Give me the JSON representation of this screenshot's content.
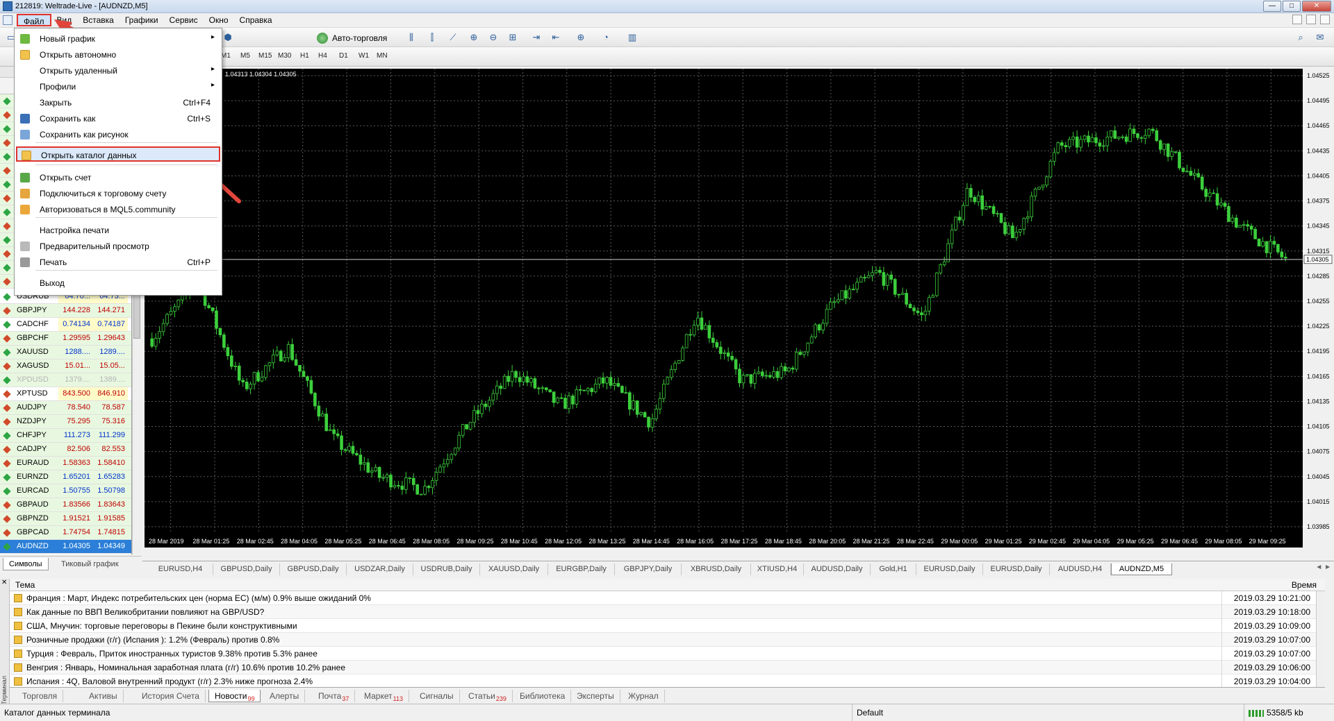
{
  "window": {
    "title": "212819: Weltrade-Live - [AUDNZD,M5]",
    "min_label": "—",
    "max_label": "□",
    "close_label": "✕"
  },
  "menubar": {
    "items": [
      "Файл",
      "Вид",
      "Вставка",
      "Графики",
      "Сервис",
      "Окно",
      "Справка"
    ],
    "active_index": 0
  },
  "toolbar": {
    "autotrade_label": "Авто-торговля",
    "timeframes": [
      "M1",
      "M5",
      "M15",
      "M30",
      "H1",
      "H4",
      "D1",
      "W1",
      "MN"
    ],
    "icons": [
      "bars-icon",
      "candles-icon",
      "line-chart-icon",
      "zoom-in-icon",
      "zoom-out-icon",
      "tile-icon",
      "autoscroll-icon",
      "shift-icon",
      "indicators-icon",
      "periods-icon",
      "templates-icon"
    ]
  },
  "file_menu": {
    "items": [
      {
        "label": "Новый график",
        "shortcut": "",
        "submenu": true,
        "icon": "new-chart-icon"
      },
      {
        "label": "Открыть автономно",
        "shortcut": "",
        "submenu": false,
        "icon": "open-offline-icon"
      },
      {
        "label": "Открыть удаленный",
        "shortcut": "",
        "submenu": true,
        "icon": ""
      },
      {
        "label": "Профили",
        "shortcut": "",
        "submenu": true,
        "icon": ""
      },
      {
        "label": "Закрыть",
        "shortcut": "Ctrl+F4",
        "submenu": false,
        "icon": ""
      },
      {
        "label": "Сохранить как",
        "shortcut": "Ctrl+S",
        "submenu": false,
        "icon": "save-icon"
      },
      {
        "label": "Сохранить как рисунок",
        "shortcut": "",
        "submenu": false,
        "icon": "save-image-icon"
      },
      {
        "label": "Открыть каталог данных",
        "shortcut": "",
        "submenu": false,
        "icon": "folder-icon"
      },
      {
        "label": "Открыть счет",
        "shortcut": "",
        "submenu": false,
        "icon": "open-account-icon"
      },
      {
        "label": "Подключиться к торговому счету",
        "shortcut": "",
        "submenu": false,
        "icon": "connect-icon"
      },
      {
        "label": "Авторизоваться в MQL5.community",
        "shortcut": "",
        "submenu": false,
        "icon": "mql5-icon"
      },
      {
        "label": "Настройка печати",
        "shortcut": "",
        "submenu": false,
        "icon": ""
      },
      {
        "label": "Предварительный просмотр",
        "shortcut": "",
        "submenu": false,
        "icon": "print-preview-icon"
      },
      {
        "label": "Печать",
        "shortcut": "Ctrl+P",
        "submenu": false,
        "icon": "print-icon"
      },
      {
        "label": "Выход",
        "shortcut": "",
        "submenu": false,
        "icon": ""
      }
    ],
    "highlighted_index": 7
  },
  "market_watch": {
    "rows": [
      {
        "symbol": "USDRUB",
        "bid": "64.70...",
        "ask": "64.73...",
        "dir": "up",
        "style": "normal"
      },
      {
        "symbol": "GBPJPY",
        "bid": "144.228",
        "ask": "144.271",
        "dir": "down",
        "style": "normal"
      },
      {
        "symbol": "CADCHF",
        "bid": "0.74134",
        "ask": "0.74187",
        "dir": "up",
        "style": "normal"
      },
      {
        "symbol": "GBPCHF",
        "bid": "1.29595",
        "ask": "1.29643",
        "dir": "down",
        "style": "normal"
      },
      {
        "symbol": "XAUUSD",
        "bid": "1288....",
        "ask": "1289....",
        "dir": "up",
        "style": "normal"
      },
      {
        "symbol": "XAGUSD",
        "bid": "15.01...",
        "ask": "15.05...",
        "dir": "down",
        "style": "normal"
      },
      {
        "symbol": "XPDUSD",
        "bid": "1379....",
        "ask": "1389....",
        "dir": "up",
        "style": "grey"
      },
      {
        "symbol": "XPTUSD",
        "bid": "843.500",
        "ask": "846.910",
        "dir": "down",
        "style": "normal"
      },
      {
        "symbol": "AUDJPY",
        "bid": "78.540",
        "ask": "78.587",
        "dir": "down",
        "style": "normal"
      },
      {
        "symbol": "NZDJPY",
        "bid": "75.295",
        "ask": "75.316",
        "dir": "down",
        "style": "normal"
      },
      {
        "symbol": "CHFJPY",
        "bid": "111.273",
        "ask": "111.299",
        "dir": "up",
        "style": "normal"
      },
      {
        "symbol": "CADJPY",
        "bid": "82.506",
        "ask": "82.553",
        "dir": "down",
        "style": "normal"
      },
      {
        "symbol": "EURAUD",
        "bid": "1.58363",
        "ask": "1.58410",
        "dir": "down",
        "style": "normal"
      },
      {
        "symbol": "EURNZD",
        "bid": "1.65201",
        "ask": "1.65283",
        "dir": "up",
        "style": "normal"
      },
      {
        "symbol": "EURCAD",
        "bid": "1.50755",
        "ask": "1.50798",
        "dir": "up",
        "style": "normal"
      },
      {
        "symbol": "GBPAUD",
        "bid": "1.83566",
        "ask": "1.83643",
        "dir": "down",
        "style": "normal"
      },
      {
        "symbol": "GBPNZD",
        "bid": "1.91521",
        "ask": "1.91585",
        "dir": "down",
        "style": "normal"
      },
      {
        "symbol": "GBPCAD",
        "bid": "1.74754",
        "ask": "1.74815",
        "dir": "down",
        "style": "normal"
      },
      {
        "symbol": "AUDNZD",
        "bid": "1.04305",
        "ask": "1.04349",
        "dir": "up",
        "style": "selected"
      }
    ],
    "tabs": [
      "Символы",
      "Тиковый график"
    ],
    "active_tab": 0
  },
  "chart": {
    "info": "1.04313 1.04304 1.04305",
    "current_price": "1.04305",
    "price_labels": [
      "1.04525",
      "1.04495",
      "1.04465",
      "1.04435",
      "1.04405",
      "1.04375",
      "1.04345",
      "1.04315",
      "1.04285",
      "1.04255",
      "1.04225",
      "1.04195",
      "1.04165",
      "1.04135",
      "1.04105",
      "1.04075",
      "1.04045",
      "1.04015",
      "1.03985"
    ],
    "time_labels": [
      "28 Mar 2019",
      "28 Mar 01:25",
      "28 Mar 02:45",
      "28 Mar 04:05",
      "28 Mar 05:25",
      "28 Mar 06:45",
      "28 Mar 08:05",
      "28 Mar 09:25",
      "28 Mar 10:45",
      "28 Mar 12:05",
      "28 Mar 13:25",
      "28 Mar 14:45",
      "28 Mar 16:05",
      "28 Mar 17:25",
      "28 Mar 18:45",
      "28 Mar 20:05",
      "28 Mar 21:25",
      "28 Mar 22:45",
      "29 Mar 00:05",
      "29 Mar 01:25",
      "29 Mar 02:45",
      "29 Mar 04:05",
      "29 Mar 05:25",
      "29 Mar 06:45",
      "29 Mar 08:05",
      "29 Mar 09:25"
    ],
    "colors": {
      "background": "#000000",
      "grid": "#5a5a5a",
      "candle": "#3ccf3c",
      "axis_text": "#ffffff"
    },
    "tabs": [
      "EURUSD,H4",
      "GBPUSD,Daily",
      "GBPUSD,Daily",
      "USDZAR,Daily",
      "USDRUB,Daily",
      "XAUUSD,Daily",
      "EURGBP,Daily",
      "GBPJPY,Daily",
      "XBRUSD,Daily",
      "XTIUSD,H4",
      "AUDUSD,Daily",
      "Gold,H1",
      "EURUSD,Daily",
      "EURUSD,Daily",
      "AUDUSD,H4",
      "AUDNZD,M5"
    ],
    "active_tab": 15
  },
  "chart_data": {
    "type": "candlestick",
    "symbol": "AUDNZD",
    "timeframe": "M5",
    "ylim": [
      1.03985,
      1.04525
    ],
    "x": [
      "28 Mar 2019",
      "28 Mar 01:25",
      "28 Mar 02:45",
      "28 Mar 04:05",
      "28 Mar 05:25",
      "28 Mar 06:45",
      "28 Mar 08:05",
      "28 Mar 09:25",
      "28 Mar 10:45",
      "28 Mar 12:05",
      "28 Mar 13:25",
      "28 Mar 14:45",
      "28 Mar 16:05",
      "28 Mar 17:25",
      "28 Mar 18:45",
      "28 Mar 20:05",
      "28 Mar 21:25",
      "28 Mar 22:45",
      "29 Mar 00:05",
      "29 Mar 01:25",
      "29 Mar 02:45",
      "29 Mar 04:05",
      "29 Mar 05:25",
      "29 Mar 06:45",
      "29 Mar 08:05",
      "29 Mar 09:25"
    ],
    "close": [
      1.0421,
      1.0428,
      1.0415,
      1.042,
      1.0409,
      1.04045,
      1.0403,
      1.0411,
      1.0417,
      1.0413,
      1.0416,
      1.0411,
      1.0424,
      1.0416,
      1.0417,
      1.0425,
      1.0429,
      1.04235,
      1.0439,
      1.0433,
      1.0444,
      1.0445,
      1.0446,
      1.044,
      1.04345,
      1.04305
    ],
    "last": 1.04305,
    "grid": true
  },
  "terminal": {
    "header_topic": "Тема",
    "header_time": "Время",
    "side_label": "Терминал",
    "close_label": "✕",
    "rows": [
      {
        "text": "Франция : Март, Индекс потребительских цен (норма ЕС) (м/м)  0.9% выше ожиданий 0%",
        "time": "2019.03.29 10:21:00"
      },
      {
        "text": "Как данные по ВВП Великобритании повлияют на GBP/USD?",
        "time": "2019.03.29 10:18:00"
      },
      {
        "text": "США, Мнучин: торговые переговоры в Пекине были конструктивными",
        "time": "2019.03.29 10:09:00"
      },
      {
        "text": "Розничные продажи (г/г) (Испания ): 1.2% (Февраль) против 0.8%",
        "time": "2019.03.29 10:07:00"
      },
      {
        "text": "Турция : Февраль, Приток иностранных туристов  9.38% против 5.3% ранее",
        "time": "2019.03.29 10:07:00"
      },
      {
        "text": "Венгрия : Январь, Номинальная заработная плата (г/г)  10.6% против 10.2% ранее",
        "time": "2019.03.29 10:06:00"
      },
      {
        "text": "Испания : 4Q, Валовой внутренний продукт  (г/г)  2.3% ниже прогноза 2.4%",
        "time": "2019.03.29 10:04:00"
      }
    ],
    "tabs": [
      {
        "label": "Торговля",
        "badge": ""
      },
      {
        "label": "Активы",
        "badge": ""
      },
      {
        "label": "История Счета",
        "badge": ""
      },
      {
        "label": "Новости",
        "badge": "99"
      },
      {
        "label": "Алерты",
        "badge": ""
      },
      {
        "label": "Почта",
        "badge": "37"
      },
      {
        "label": "Маркет",
        "badge": "113"
      },
      {
        "label": "Сигналы",
        "badge": ""
      },
      {
        "label": "Статьи",
        "badge": "239"
      },
      {
        "label": "Библиотека",
        "badge": ""
      },
      {
        "label": "Эксперты",
        "badge": ""
      },
      {
        "label": "Журнал",
        "badge": ""
      }
    ],
    "active_tab": 3
  },
  "status": {
    "left": "Каталог данных терминала",
    "profile": "Default",
    "traffic": "5358/5 kb"
  }
}
